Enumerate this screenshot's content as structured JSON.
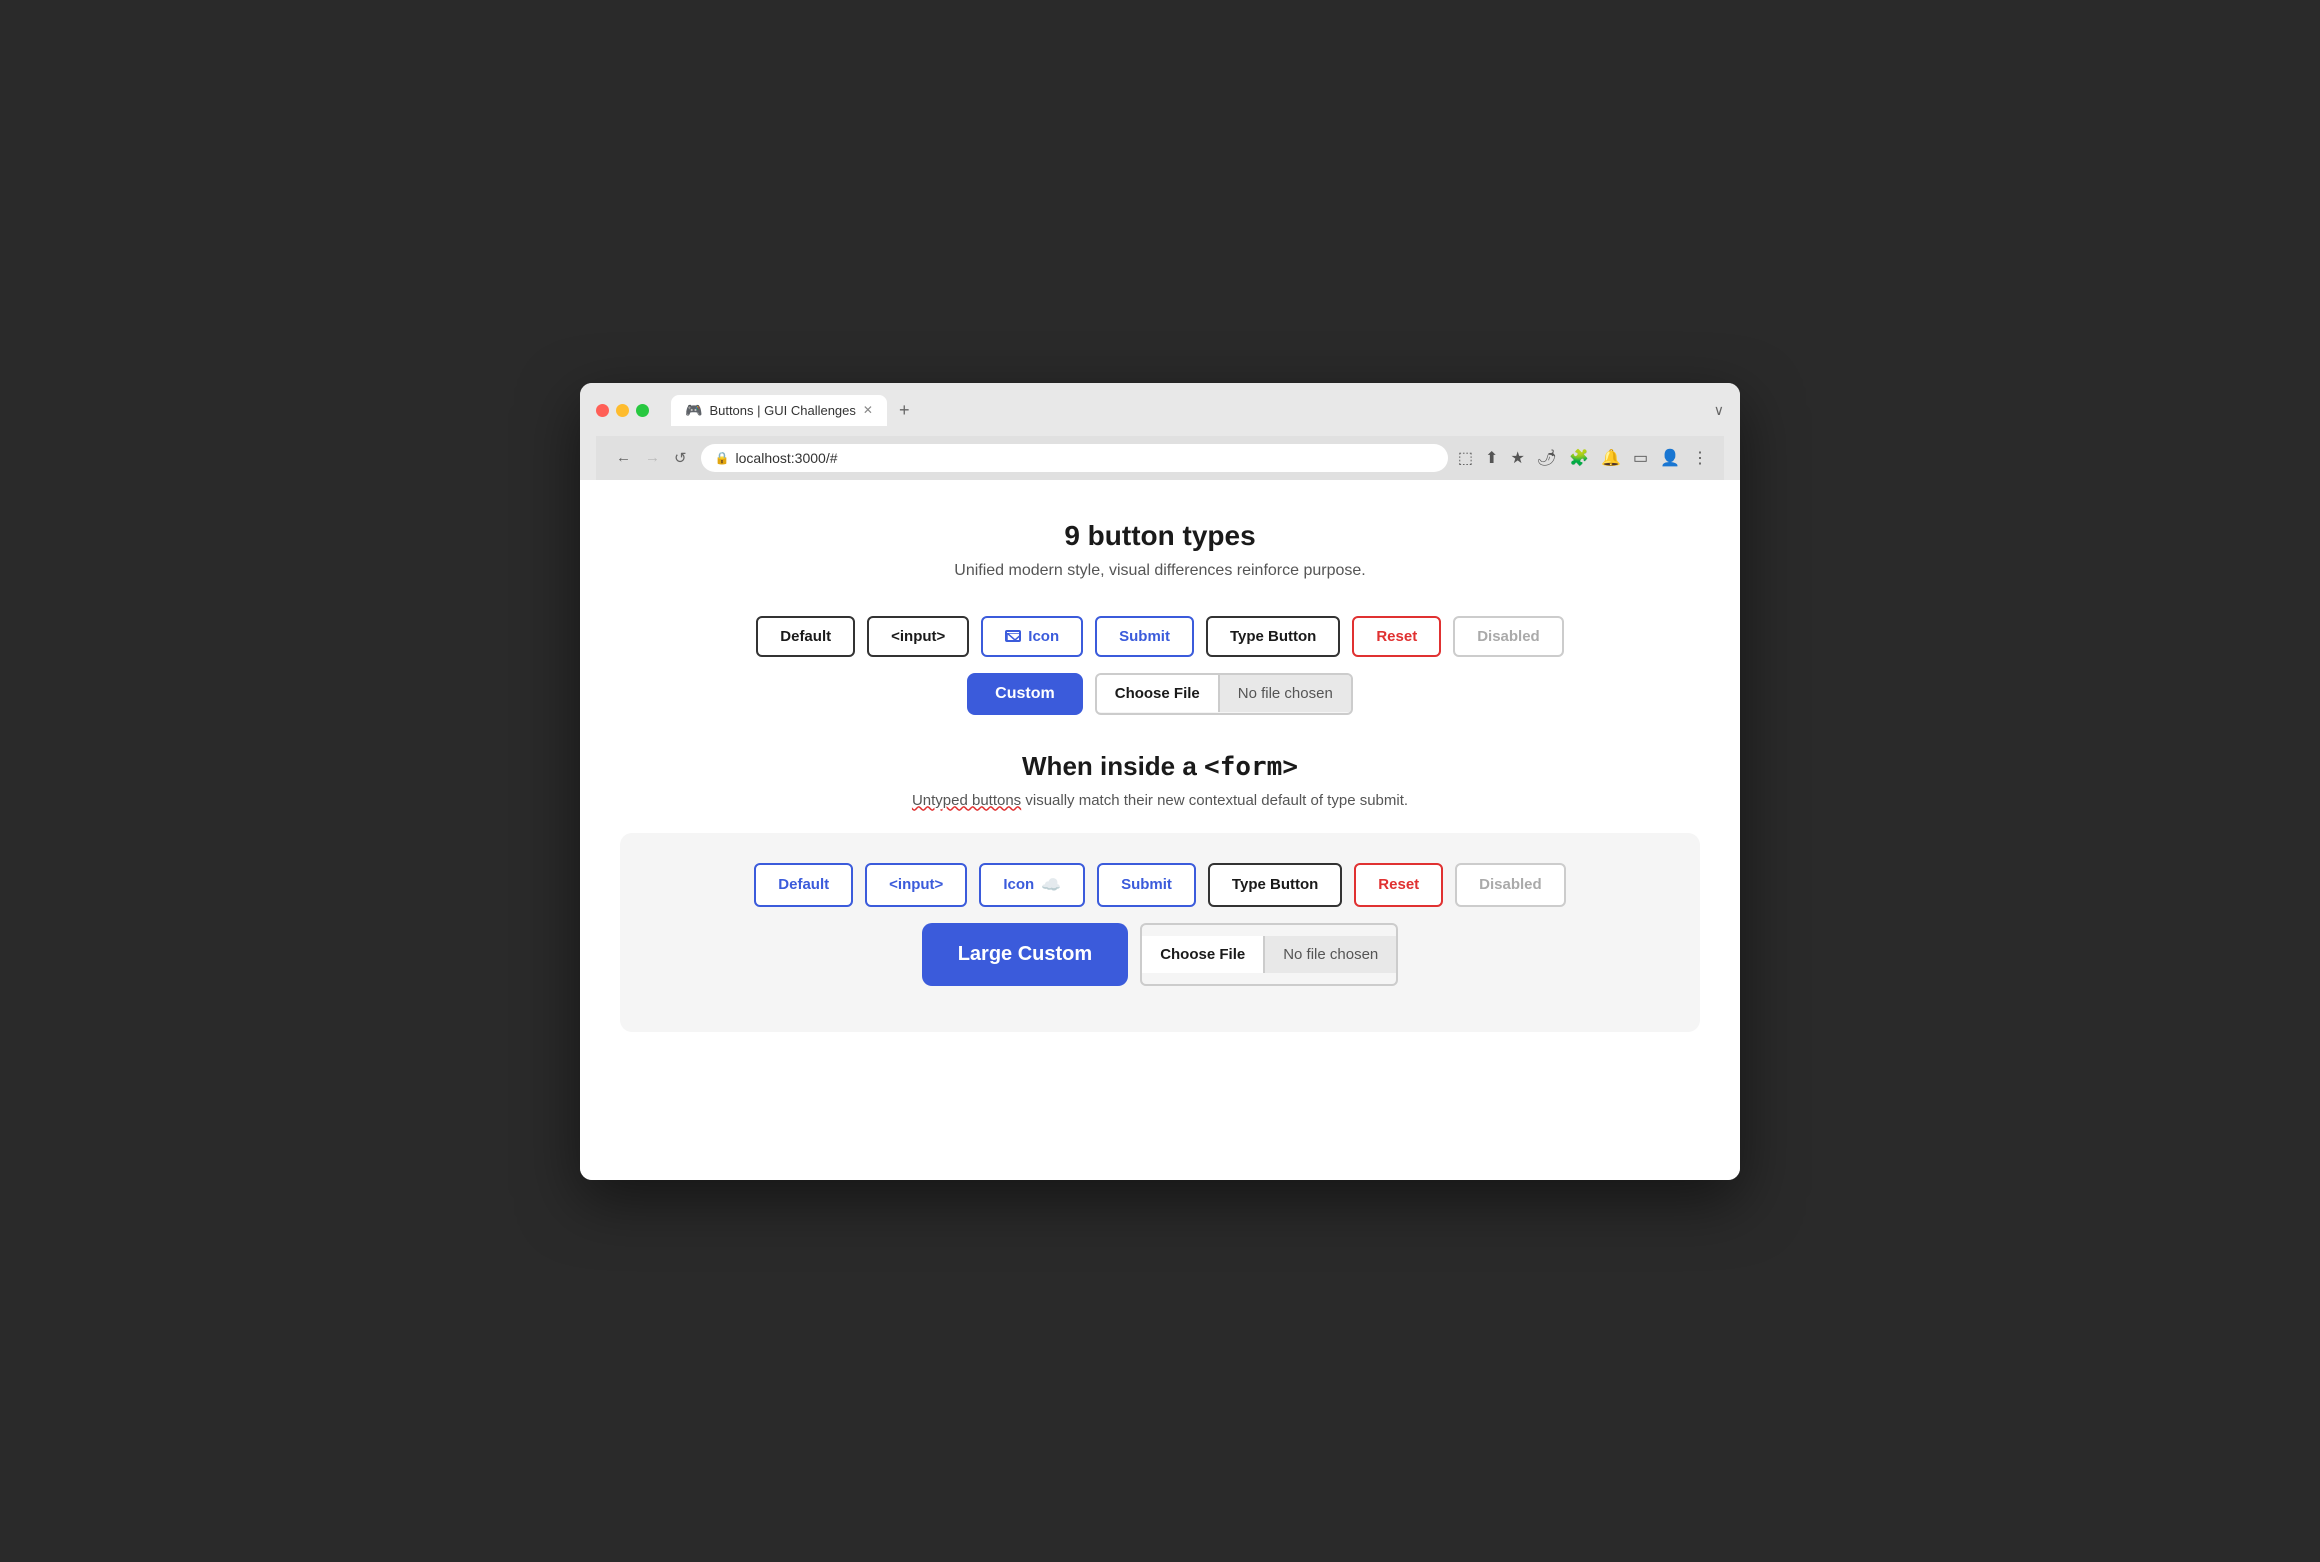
{
  "browser": {
    "tab_title": "Buttons | GUI Challenges",
    "tab_icon": "🎮",
    "url": "localhost:3000/#",
    "new_tab_label": "+",
    "chevron": "∨",
    "nav": {
      "back": "←",
      "forward": "→",
      "reload": "↺"
    }
  },
  "page": {
    "title": "9 button types",
    "subtitle": "Unified modern style, visual differences reinforce purpose.",
    "section2_title_prefix": "When inside a ",
    "section2_title_code": "<form>",
    "section2_subtitle_part1": "Untyped buttons",
    "section2_subtitle_part2": " visually match their new contextual default of type submit."
  },
  "row1": {
    "default": "Default",
    "input": "<input>",
    "icon": "Icon",
    "submit": "Submit",
    "type_button": "Type Button",
    "reset": "Reset",
    "disabled": "Disabled"
  },
  "row2": {
    "custom": "Custom",
    "choose_file": "Choose File",
    "no_file": "No file chosen"
  },
  "form_row1": {
    "default": "Default",
    "input": "<input>",
    "icon": "Icon",
    "submit": "Submit",
    "type_button": "Type Button",
    "reset": "Reset",
    "disabled": "Disabled"
  },
  "form_row2": {
    "large_custom": "Large Custom",
    "choose_file": "Choose File",
    "no_file": "No file chosen"
  }
}
